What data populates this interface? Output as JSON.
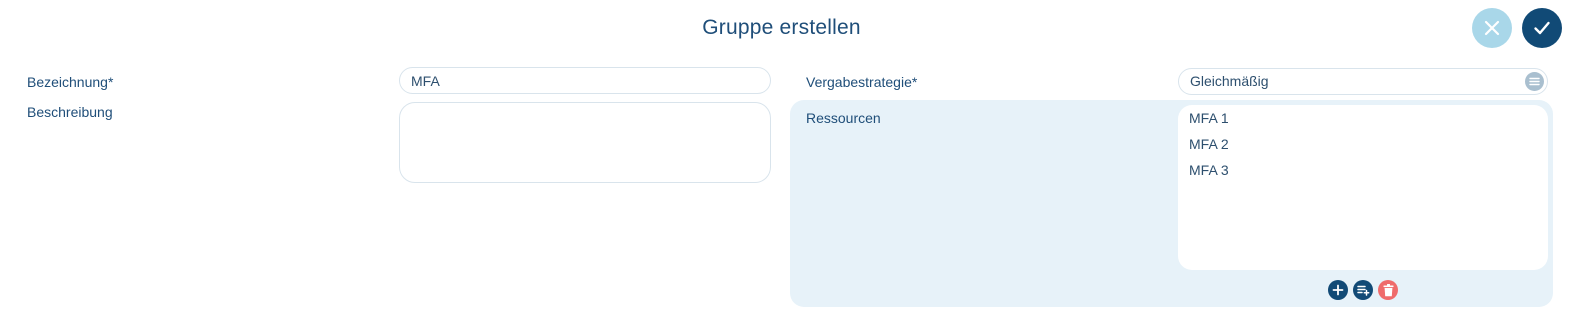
{
  "dialog": {
    "title": "Gruppe erstellen",
    "cancel_icon": "close-icon",
    "confirm_icon": "check-icon"
  },
  "form": {
    "bezeichnung_label": "Bezeichnung*",
    "bezeichnung_value": "MFA",
    "beschreibung_label": "Beschreibung",
    "beschreibung_value": "",
    "vergabestrategie_label": "Vergabestrategie*",
    "vergabestrategie_value": "Gleichmäßig",
    "ressourcen_label": "Ressourcen",
    "ressourcen": [
      "MFA 1",
      "MFA 2",
      "MFA 3"
    ]
  },
  "actions": {
    "add_icon": "plus-icon",
    "add_list_icon": "playlist-add-icon",
    "delete_icon": "trash-icon"
  },
  "colors": {
    "primary": "#114a76",
    "cancel": "#a9d7e9",
    "danger": "#ef6b6b",
    "panel": "#e7f2f9"
  }
}
